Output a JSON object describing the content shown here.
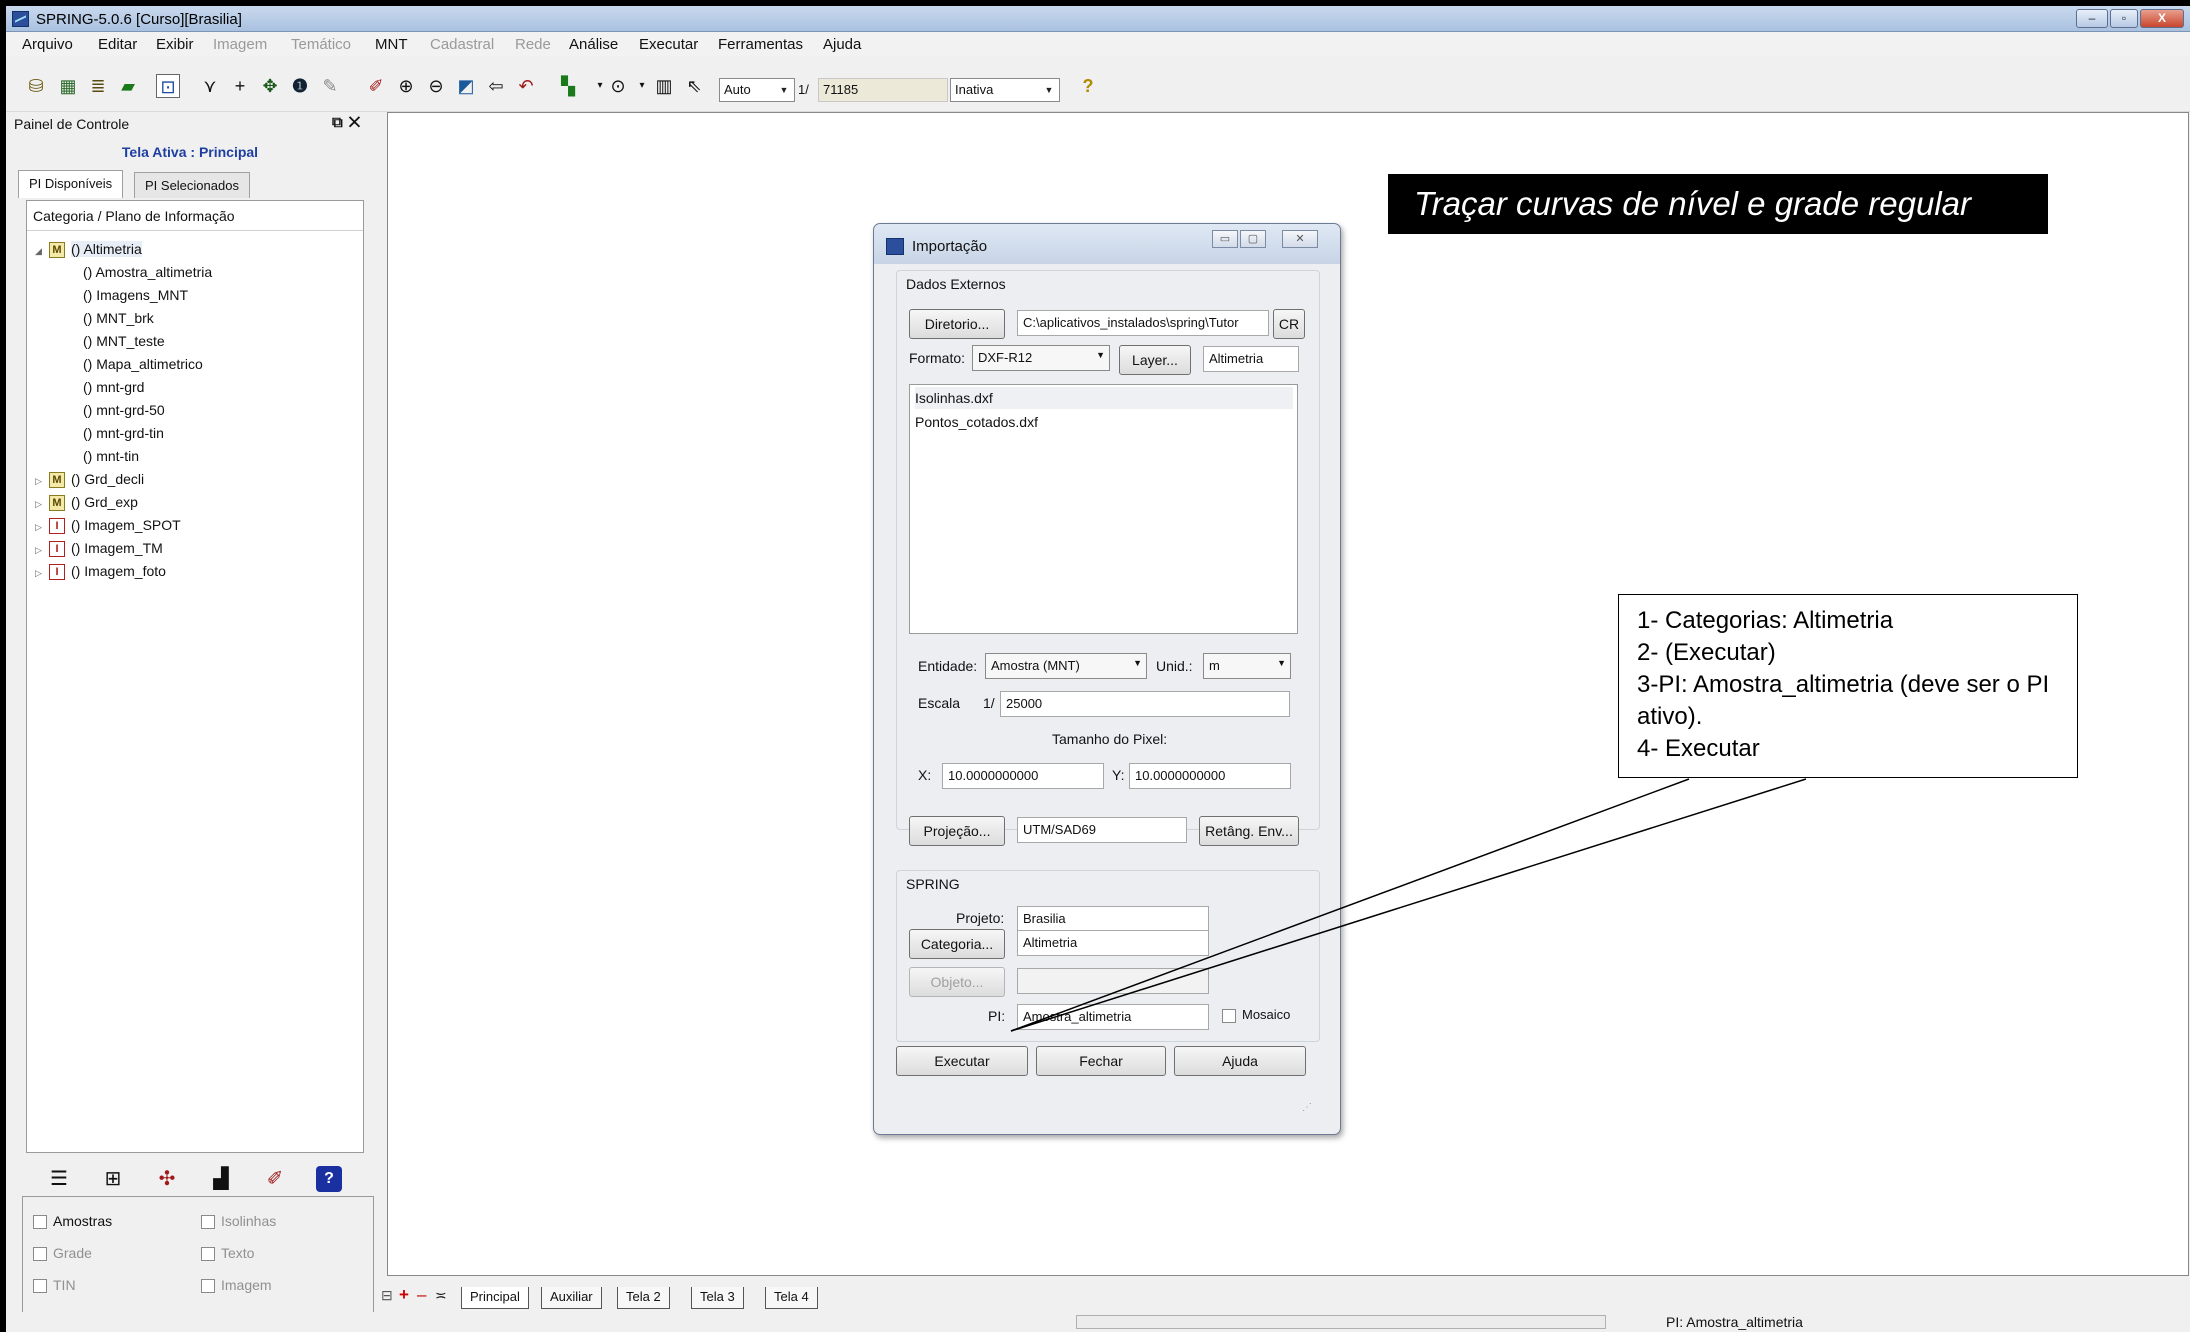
{
  "window": {
    "title": "SPRING-5.0.6 [Curso][Brasilia]",
    "caption_buttons": [
      "–",
      "▫",
      "X"
    ]
  },
  "menus": [
    {
      "label": "Arquivo",
      "enabled": true
    },
    {
      "label": "Editar",
      "enabled": true
    },
    {
      "label": "Exibir",
      "enabled": true
    },
    {
      "label": "Imagem",
      "enabled": false
    },
    {
      "label": "Temático",
      "enabled": false
    },
    {
      "label": "MNT",
      "enabled": true
    },
    {
      "label": "Cadastral",
      "enabled": false
    },
    {
      "label": "Rede",
      "enabled": false
    },
    {
      "label": "Análise",
      "enabled": true
    },
    {
      "label": "Executar",
      "enabled": true
    },
    {
      "label": "Ferramentas",
      "enabled": true
    },
    {
      "label": "Ajuda",
      "enabled": true
    }
  ],
  "toolbar": {
    "zoom_mode": "Auto",
    "scale_prefix": "1/",
    "scale_value": "71185",
    "state": "Inativa"
  },
  "panel": {
    "title": "Painel de Controle",
    "active_screen": "Tela Ativa : Principal",
    "tabs": [
      "PI Disponíveis",
      "PI Selecionados"
    ],
    "tree_header": "Categoria / Plano de Informação",
    "tree": [
      {
        "label": "() Altimetria",
        "type": "M",
        "expanded": true,
        "level": 0
      },
      {
        "label": "() Amostra_altimetria",
        "level": 1
      },
      {
        "label": "() Imagens_MNT",
        "level": 1
      },
      {
        "label": "() MNT_brk",
        "level": 1
      },
      {
        "label": "() MNT_teste",
        "level": 1
      },
      {
        "label": "() Mapa_altimetrico",
        "level": 1
      },
      {
        "label": "() mnt-grd",
        "level": 1
      },
      {
        "label": "() mnt-grd-50",
        "level": 1
      },
      {
        "label": "() mnt-grd-tin",
        "level": 1
      },
      {
        "label": "() mnt-tin",
        "level": 1
      },
      {
        "label": "() Grd_decli",
        "type": "M",
        "expanded": false,
        "level": 0
      },
      {
        "label": "() Grd_exp",
        "type": "M",
        "expanded": false,
        "level": 0
      },
      {
        "label": "() Imagem_SPOT",
        "type": "I",
        "expanded": false,
        "level": 0
      },
      {
        "label": "() Imagem_TM",
        "type": "I",
        "expanded": false,
        "level": 0
      },
      {
        "label": "() Imagem_foto",
        "type": "I",
        "expanded": false,
        "level": 0
      }
    ],
    "checks": [
      {
        "label": "Amostras",
        "enabled": true
      },
      {
        "label": "Isolinhas",
        "enabled": false
      },
      {
        "label": "Grade",
        "enabled": false
      },
      {
        "label": "Texto",
        "enabled": false
      },
      {
        "label": "TIN",
        "enabled": false
      },
      {
        "label": "Imagem",
        "enabled": false
      }
    ]
  },
  "dialog": {
    "title": "Importação",
    "external_group": "Dados Externos",
    "dir_button": "Diretorio...",
    "dir_path": "C:\\aplicativos_instalados\\spring\\Tutor",
    "cr_button": "CR",
    "format_label": "Formato:",
    "format_value": "DXF-R12",
    "layer_button": "Layer...",
    "layer_value": "Altimetria",
    "files": [
      "Isolinhas.dxf",
      "Pontos_cotados.dxf"
    ],
    "entity_label": "Entidade:",
    "entity_value": "Amostra (MNT)",
    "unit_label": "Unid.:",
    "unit_value": "m",
    "scale_label": "Escala",
    "scale_prefix": "1/",
    "scale_value": "25000",
    "pixel_label": "Tamanho do Pixel:",
    "x_label": "X:",
    "x_value": "10.0000000000",
    "y_label": "Y:",
    "y_value": "10.0000000000",
    "proj_button": "Projeção...",
    "proj_value": "UTM/SAD69",
    "env_button": "Retâng. Env...",
    "spring_group": "SPRING",
    "project_label": "Projeto:",
    "project_value": "Brasilia",
    "category_button": "Categoria...",
    "category_value": "Altimetria",
    "object_button": "Objeto...",
    "object_value": "",
    "pi_label": "PI:",
    "pi_value": "Amostra_altimetria",
    "mosaic_label": "Mosaico",
    "execute_button": "Executar",
    "close_button": "Fechar",
    "help_button": "Ajuda"
  },
  "annotation": {
    "banner": "Traçar curvas de nível e grade regular",
    "steps": [
      "1- Categorias: Altimetria",
      "2- (Executar)",
      "3-PI: Amostra_altimetria (deve ser o PI ativo).",
      "4- Executar"
    ]
  },
  "view_tabs": [
    "Principal",
    "Auxiliar",
    "Tela 2",
    "Tela 3",
    "Tela 4"
  ],
  "status": {
    "pi": "PI: Amostra_altimetria"
  }
}
